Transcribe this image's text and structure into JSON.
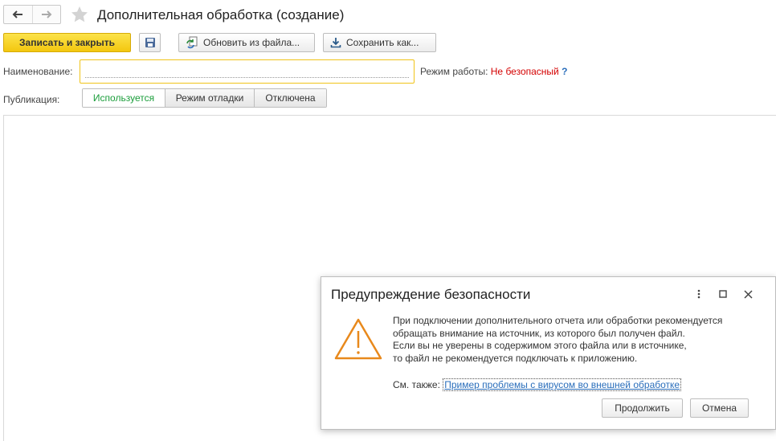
{
  "window": {
    "title": "Дополнительная обработка (создание)",
    "back_icon": "arrow-left-icon",
    "forward_icon": "arrow-right-icon",
    "favorite_icon": "star-icon"
  },
  "toolbar": {
    "save_close_label": "Записать и закрыть",
    "save_icon": "floppy-icon",
    "update_label": "Обновить из файла...",
    "update_icon": "refresh-file-icon",
    "save_as_label": "Сохранить как...",
    "save_as_icon": "download-icon"
  },
  "form": {
    "name_label": "Наименование:",
    "name_value": "",
    "mode_label": "Режим работы:",
    "mode_value": "Не безопасный",
    "mode_help": "?",
    "publication_label": "Публикация:",
    "publication_options": [
      "Используется",
      "Режим отладки",
      "Отключена"
    ],
    "publication_selected": "Используется"
  },
  "dialog": {
    "title": "Предупреждение безопасности",
    "icon": "warning-triangle-icon",
    "message_lines": [
      "При подключении дополнительного отчета или обработки рекомендуется",
      "обращать внимание на источник, из которого был получен файл.",
      "Если вы не уверены в содержимом этого файла или в источнике,",
      "то файл не рекомендуется подключать к приложению."
    ],
    "see_also_label": "См. также:",
    "see_also_link": "Пример проблемы с вирусом во внешней обработке",
    "continue_label": "Продолжить",
    "cancel_label": "Отмена"
  },
  "colors": {
    "primary_button": "#f3c70f",
    "field_border": "#f0c419",
    "unsafe_text": "#d40000",
    "active_option": "#1a9d3a",
    "warning_icon": "#e8891c",
    "link": "#2a6ebb"
  }
}
